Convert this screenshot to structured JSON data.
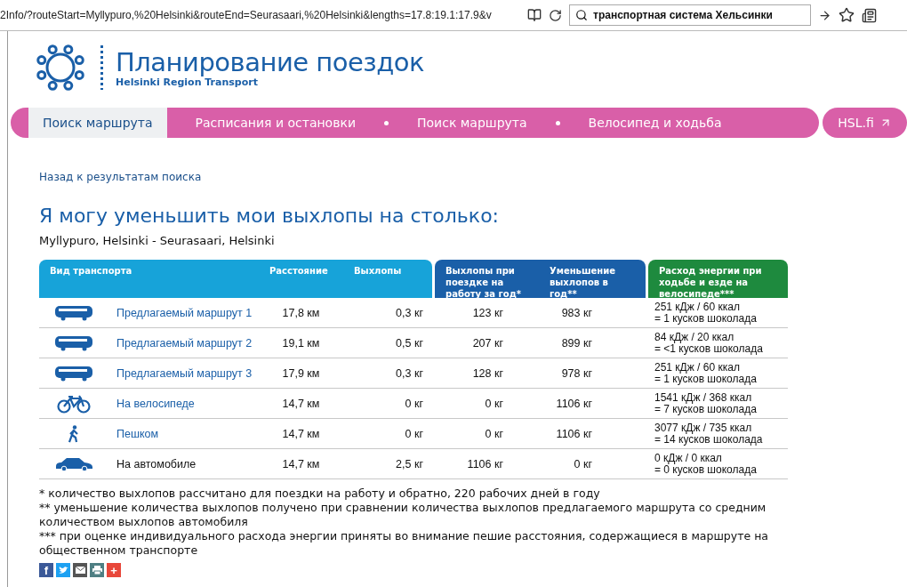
{
  "browser": {
    "url": "2Info/?routeStart=Myllypuro,%20Helsinki&routeEnd=Seurasaari,%20Helsinki&lengths=17.8:19.1:17.9&v",
    "search": "транспортная система Хельсинки"
  },
  "header": {
    "title": "Планирование поездок",
    "subtitle": "Helsinki Region Transport"
  },
  "nav": {
    "tabs": [
      {
        "label": "Поиск маршрута",
        "selected": true
      },
      {
        "label": "Расписания и остановки",
        "selected": false
      },
      {
        "label": "Поиск маршрута",
        "selected": false
      },
      {
        "label": "Велосипед и ходьба",
        "selected": false
      }
    ],
    "external": "HSL.fi"
  },
  "back_link": "Назад к результатам поиска",
  "heading": "Я могу уменьшить мои выхлопы на столько:",
  "route": "Myllypuro, Helsinki - Seurasaari, Helsinki",
  "table": {
    "columns": [
      {
        "label": "Вид транспорта",
        "color": "#17a3d9"
      },
      {
        "label": "Расстояние",
        "color": "#17a3d9"
      },
      {
        "label": "Выхлопы",
        "color": "#17a3d9"
      },
      {
        "label": "Выхлопы при поездке на работу за год*",
        "color": "#1a5fa8"
      },
      {
        "label": "Уменьшение выхлопов в год**",
        "color": "#1a5fa8"
      },
      {
        "label": "Расход энергии при ходьбе и езде на велосипеде***",
        "color": "#1e8a3e"
      }
    ],
    "rows": [
      {
        "kind": "bus",
        "name": "Предлагаемый маршрут 1",
        "link": true,
        "distance": "17,8 км",
        "emissions": "0,3 кг",
        "yearly": "123 кг",
        "reduction": "983 кг",
        "energy": "251 кДж / 60 ккал",
        "chocolate": "= 1 кусков шоколада"
      },
      {
        "kind": "bus",
        "name": "Предлагаемый маршрут 2",
        "link": true,
        "distance": "19,1 км",
        "emissions": "0,5 кг",
        "yearly": "207 кг",
        "reduction": "899 кг",
        "energy": "84 кДж / 20 ккал",
        "chocolate": "= <1 кусков шоколада"
      },
      {
        "kind": "bus",
        "name": "Предлагаемый маршрут 3",
        "link": true,
        "distance": "17,9 км",
        "emissions": "0,3 кг",
        "yearly": "128 кг",
        "reduction": "978 кг",
        "energy": "251 кДж / 60 ккал",
        "chocolate": "= 1 кусков шоколада"
      },
      {
        "kind": "bike",
        "name": "На велосипеде",
        "link": true,
        "distance": "14,7 км",
        "emissions": "0 кг",
        "yearly": "0 кг",
        "reduction": "1106 кг",
        "energy": "1541 кДж / 368 ккал",
        "chocolate": "= 7 кусков шоколада"
      },
      {
        "kind": "walk",
        "name": "Пешком",
        "link": true,
        "distance": "14,7 км",
        "emissions": "0 кг",
        "yearly": "0 кг",
        "reduction": "1106 кг",
        "energy": "3077 кДж / 735 ккал",
        "chocolate": "= 14 кусков шоколада"
      },
      {
        "kind": "car",
        "name": "На автомобиле",
        "link": false,
        "distance": "14,7 км",
        "emissions": "2,5 кг",
        "yearly": "1106 кг",
        "reduction": "0 кг",
        "energy": "0 кДж / 0 ккал",
        "chocolate": "= 0 кусков шоколада"
      }
    ]
  },
  "footnotes": [
    "* количество выхлопов рассчитано для поездки на работу и обратно, 220 рабочих дней в году",
    "** уменьшение количества выхлопов получено при сравнении количества выхлопов предлагаемого маршрута со средним количеством выхлопов автомобиля",
    "*** при оценке индивидуального расхода энергии приняты во внимание пешие расстояния, содержащиеся в маршруте на общественном транспорте"
  ],
  "share": [
    {
      "kind": "facebook",
      "glyph": "f",
      "color": "#3b5998"
    },
    {
      "kind": "twitter",
      "color": "#1da1f2"
    },
    {
      "kind": "email",
      "color": "#555555"
    },
    {
      "kind": "print",
      "color": "#4f7f83"
    },
    {
      "kind": "plus",
      "glyph": "+",
      "color": "#e8473a"
    }
  ]
}
